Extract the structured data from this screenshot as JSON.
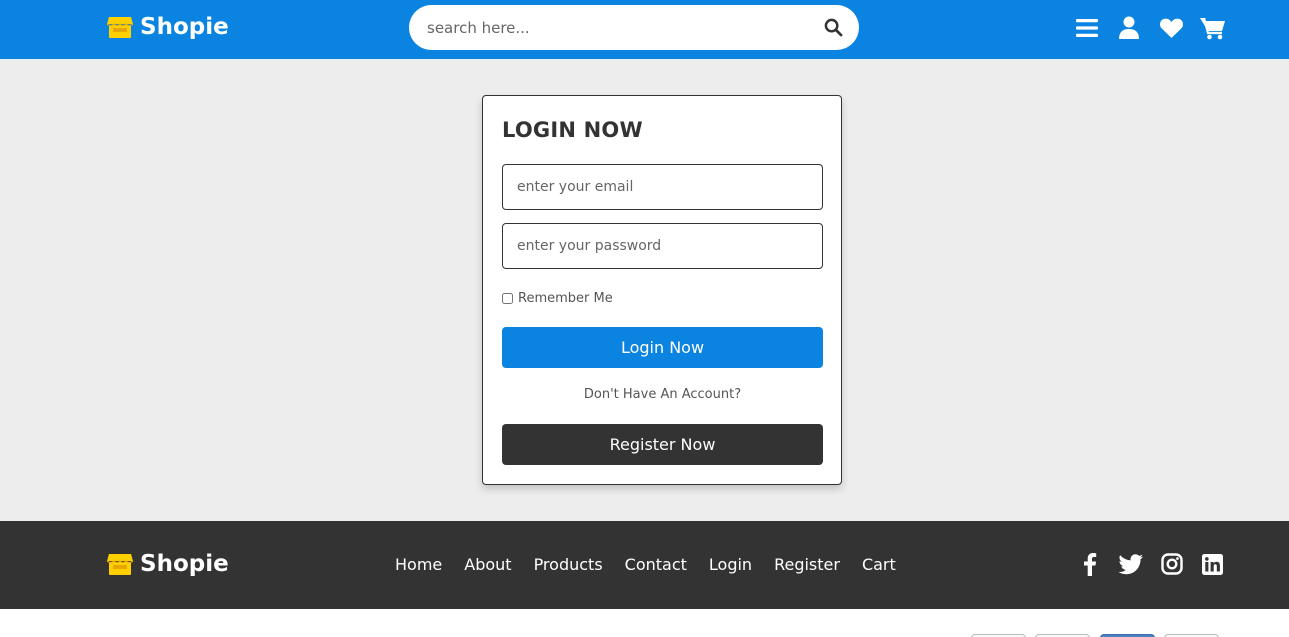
{
  "header": {
    "brand": "Shopie",
    "search_placeholder": "search here...",
    "icons": [
      "menu-icon",
      "user-icon",
      "heart-icon",
      "cart-icon"
    ]
  },
  "login": {
    "title": "LOGIN NOW",
    "email_placeholder": "enter your email",
    "password_placeholder": "enter your password",
    "remember_label": "Remember Me",
    "login_button": "Login Now",
    "no_account_text": "Don't Have An Account?",
    "register_button": "Register Now"
  },
  "footer": {
    "brand": "Shopie",
    "links": [
      "Home",
      "About",
      "Products",
      "Contact",
      "Login",
      "Register",
      "Cart"
    ],
    "social": [
      "facebook-icon",
      "twitter-icon",
      "instagram-icon",
      "linkedin-icon"
    ]
  },
  "colors": {
    "primary": "#0a84e0",
    "dark": "#333333",
    "logo_yellow": "#ffd000",
    "page_bg": "#ededed"
  }
}
